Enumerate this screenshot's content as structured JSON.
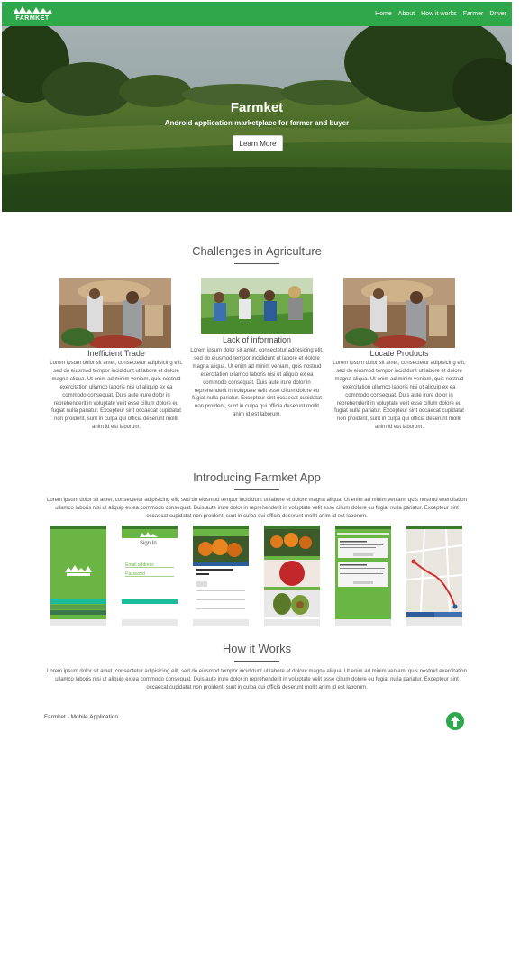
{
  "navbar": {
    "logo_text": "FARMKET",
    "links": [
      "Home",
      "About",
      "How it works",
      "Farmer",
      "Driver"
    ]
  },
  "hero": {
    "title": "Farmket",
    "subtitle": "Android application marketplace for farmer and buyer",
    "button_label": "Learn More"
  },
  "challenges": {
    "title": "Challenges in Agriculture",
    "cards": [
      {
        "title": "Inefficient Trade",
        "text": "Lorem ipsum dolor sit amet, consectetur adipisicing elit, sed do eiusmod tempor incididunt ut labore et dolore magna aliqua. Ut enim ad minim veniam, quis nostrud exercitation ullamco laboris nisi ut aliquip ex ea commodo consequat. Duis aute irure dolor in reprehenderit in voluptate velit esse cillum dolore eu fugiat nulla pariatur. Excepteur sint occaecat cupidatat non proident, sunt in culpa qui officia deserunt mollit anim id est laborum."
      },
      {
        "title": "Lack of information",
        "text": "Lorem ipsum dolor sit amet, consectetur adipisicing elit, sed do eiusmod tempor incididunt ut labore et dolore magna aliqua. Ut enim ad minim veniam, quis nostrud exercitation ullamco laboris nisi ut aliquip ex ea commodo consequat. Duis aute irure dolor in reprehenderit in voluptate velit esse cillum dolore eu fugiat nulla pariatur. Excepteur sint occaecat cupidatat non proident, sunt in culpa qui officia deserunt mollit anim id est laborum."
      },
      {
        "title": "Locate Products",
        "text": "Lorem ipsum dolor sit amet, consectetur adipisicing elit, sed do eiusmod tempor incididunt ut labore et dolore magna aliqua. Ut enim ad minim veniam, quis nostrud exercitation ullamco laboris nisi ut aliquip ex ea commodo consequat. Duis aute irure dolor in reprehenderit in voluptate velit esse cillum dolore eu fugiat nulla pariatur. Excepteur sint occaecat cupidatat non proident, sunt in culpa qui officia deserunt mollit anim id est laborum."
      }
    ]
  },
  "introducing": {
    "title": "Introducing Farmket App",
    "text": "Lorem ipsum dolor sit amet, consectetur adipisicing elit, sed do eiusmod tempor incididunt ut labore et dolore magna aliqua. Ut enim ad minim veniam, quis nostrud exercitation ullamco laboris nisi ut aliquip ex ea commodo consequat. Duis aute irure dolor in reprehenderit in voluptate velit esse cillum dolore eu fugiat nulla pariatur. Excepteur sint occaecat cupidatat non proident, sunt in culpa qui officia deserunt mollit anim id est laborum.",
    "screens": {
      "signin_title": "Sign In",
      "email_label": "Email address",
      "password_label": "Password",
      "login_label": "LOG IN"
    }
  },
  "how_it_works": {
    "title": "How it Works",
    "text": "Lorem ipsum dolor sit amet, consectetur adipisicing elit, sed do eiusmod tempor incididunt ut labore et dolore magna aliqua. Ut enim ad minim veniam, quis nostrud exercitation ullamco laboris nisi ut aliquip ex ea commodo consequat. Duis aute irure dolor in reprehenderit in voluptate velit esse cillum dolore eu fugiat nulla pariatur. Excepteur sint occaecat cupidatat non proident, sunt in culpa qui officia deserunt mollit anim id est laborum."
  },
  "footer": {
    "text": "Farmket - Mobile Application",
    "to_top_icon": "arrow-up-circle-icon"
  },
  "colors": {
    "brand_green": "#2ea84a",
    "app_green": "#6bb544",
    "teal": "#1abc9c"
  }
}
